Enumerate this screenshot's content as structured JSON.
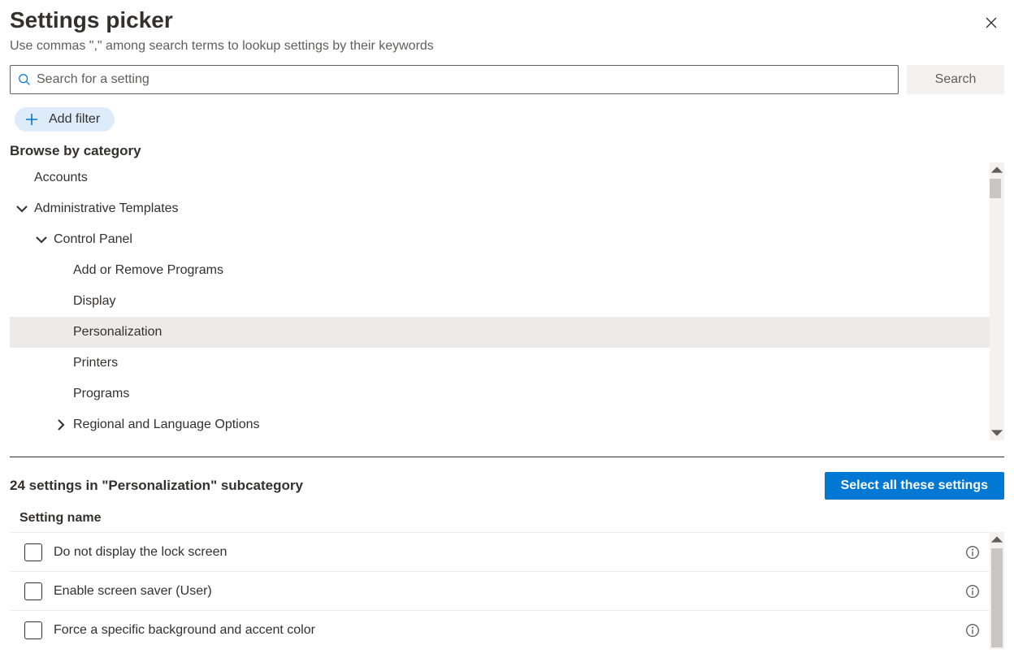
{
  "header": {
    "title": "Settings picker",
    "subtitle": "Use commas \",\" among search terms to lookup settings by their keywords"
  },
  "search": {
    "placeholder": "Search for a setting",
    "button": "Search"
  },
  "filter": {
    "add_label": "Add filter"
  },
  "browse": {
    "heading": "Browse by category"
  },
  "tree": {
    "accounts": "Accounts",
    "admin_templates": "Administrative Templates",
    "control_panel": "Control Panel",
    "add_remove": "Add or Remove Programs",
    "display": "Display",
    "personalization": "Personalization",
    "printers": "Printers",
    "programs": "Programs",
    "regional": "Regional and Language Options"
  },
  "results": {
    "count_text": "24 settings in \"Personalization\" subcategory",
    "select_all": "Select all these settings",
    "column_setting_name": "Setting name",
    "rows": [
      "Do not display the lock screen",
      "Enable screen saver (User)",
      "Force a specific background and accent color"
    ]
  }
}
